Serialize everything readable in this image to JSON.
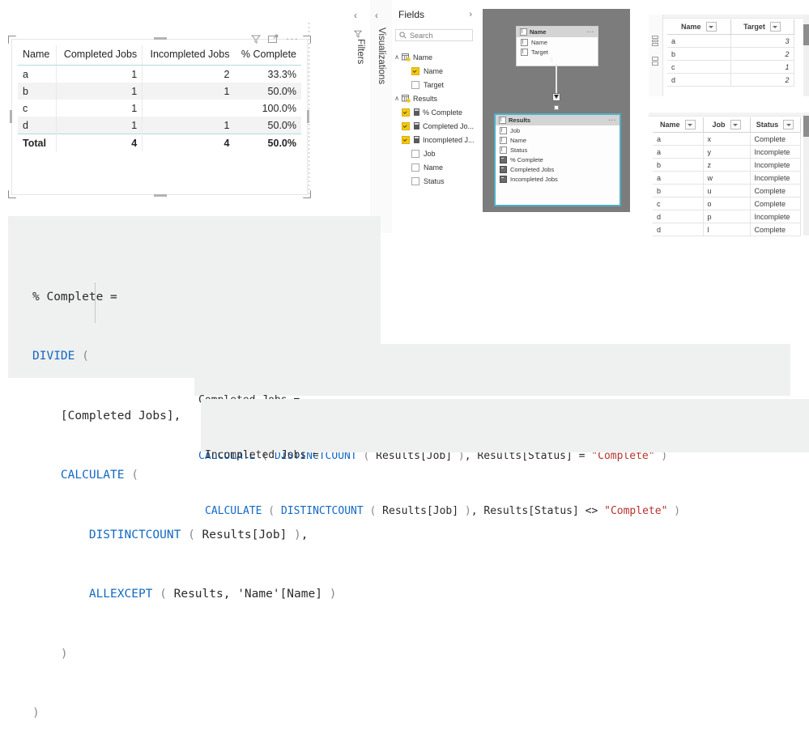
{
  "visual": {
    "name": "table-visual",
    "toolbar": {
      "filter_icon": "filter-icon",
      "focus_icon": "focus-mode-icon",
      "more_label": "···"
    },
    "table": {
      "columns": [
        "Name",
        "Completed Jobs",
        "Incompleted Jobs",
        "% Complete"
      ],
      "rows": [
        [
          "a",
          "1",
          "2",
          "33.3%"
        ],
        [
          "b",
          "1",
          "1",
          "50.0%"
        ],
        [
          "c",
          "1",
          "",
          "100.0%"
        ],
        [
          "d",
          "1",
          "1",
          "50.0%"
        ]
      ],
      "total": [
        "Total",
        "4",
        "4",
        "50.0%"
      ]
    }
  },
  "panes": {
    "filters": {
      "label": "Filters",
      "chevron": "‹",
      "icon": "filter-icon"
    },
    "visualizations": {
      "label": "Visualizations",
      "chevron": "‹"
    },
    "fields": {
      "title": "Fields",
      "chevron": "›",
      "search": {
        "placeholder": "Search",
        "value": "",
        "icon": "search-icon"
      },
      "tables": [
        {
          "name": "Name",
          "expanded": "∧",
          "fields": [
            {
              "label": "Name",
              "checked": true,
              "kind": "column"
            },
            {
              "label": "Target",
              "checked": false,
              "kind": "column"
            }
          ]
        },
        {
          "name": "Results",
          "expanded": "∧",
          "fields": [
            {
              "label": "% Complete",
              "checked": true,
              "kind": "measure"
            },
            {
              "label": "Completed Jo...",
              "checked": true,
              "kind": "measure"
            },
            {
              "label": "Incompleted J...",
              "checked": true,
              "kind": "measure"
            },
            {
              "label": "Job",
              "checked": false,
              "kind": "column"
            },
            {
              "label": "Name",
              "checked": false,
              "kind": "column"
            },
            {
              "label": "Status",
              "checked": false,
              "kind": "column"
            }
          ]
        }
      ]
    }
  },
  "model": {
    "tables": [
      {
        "title": "Name",
        "more_label": "···",
        "fields": [
          {
            "label": "Name",
            "kind": "column"
          },
          {
            "label": "Target",
            "kind": "column"
          }
        ]
      },
      {
        "title": "Results",
        "more_label": "···",
        "selected": true,
        "fields": [
          {
            "label": "Job",
            "kind": "column"
          },
          {
            "label": "Name",
            "kind": "column"
          },
          {
            "label": "Status",
            "kind": "column"
          },
          {
            "label": "% Complete",
            "kind": "measure"
          },
          {
            "label": "Completed Jobs",
            "kind": "measure"
          },
          {
            "label": "Incompleted Jobs",
            "kind": "measure"
          }
        ]
      }
    ],
    "relationship": {
      "one_label": "1",
      "many_label": "*"
    },
    "canvas_color": "#7c7c7c"
  },
  "grids": [
    {
      "id": "grid-name",
      "columns": [
        "Name",
        "Target"
      ],
      "rows": [
        [
          "a",
          "3"
        ],
        [
          "b",
          "2"
        ],
        [
          "c",
          "1"
        ],
        [
          "d",
          "2"
        ]
      ]
    },
    {
      "id": "grid-results",
      "columns": [
        "Name",
        "Job",
        "Status"
      ],
      "rows": [
        [
          "a",
          "x",
          "Complete"
        ],
        [
          "a",
          "y",
          "Incomplete"
        ],
        [
          "b",
          "z",
          "Incomplete"
        ],
        [
          "a",
          "w",
          "Incomplete"
        ],
        [
          "b",
          "u",
          "Complete"
        ],
        [
          "c",
          "o",
          "Complete"
        ],
        [
          "d",
          "p",
          "Incomplete"
        ],
        [
          "d",
          "l",
          "Complete"
        ]
      ]
    }
  ],
  "code_blocks": {
    "pct_complete": {
      "name": "% Complete",
      "text": "% Complete =\nDIVIDE (\n    [Completed Jobs],\n    CALCULATE (\n        DISTINCTCOUNT ( Results[Job] ),\n        ALLEXCEPT ( Results, 'Name'[Name] )\n    )\n)"
    },
    "completed_jobs": {
      "name": "Completed Jobs",
      "text": "Completed Jobs =\nCALCULATE ( DISTINCTCOUNT ( Results[Job] ), Results[Status] = \"Complete\" )"
    },
    "incompleted_jobs": {
      "name": "Incompleted Jobs",
      "text": "Incompleted Jobs =\nCALCULATE ( DISTINCTCOUNT ( Results[Job] ), Results[Status] <> \"Complete\" )"
    }
  },
  "colors": {
    "code_bg": "#eff0f0",
    "keyword": "#1268c3",
    "string": "#b5332e",
    "header_rule": "#b5dbdd",
    "checkbox_on": "#f2c811",
    "model_selected": "#4eb0c4"
  }
}
